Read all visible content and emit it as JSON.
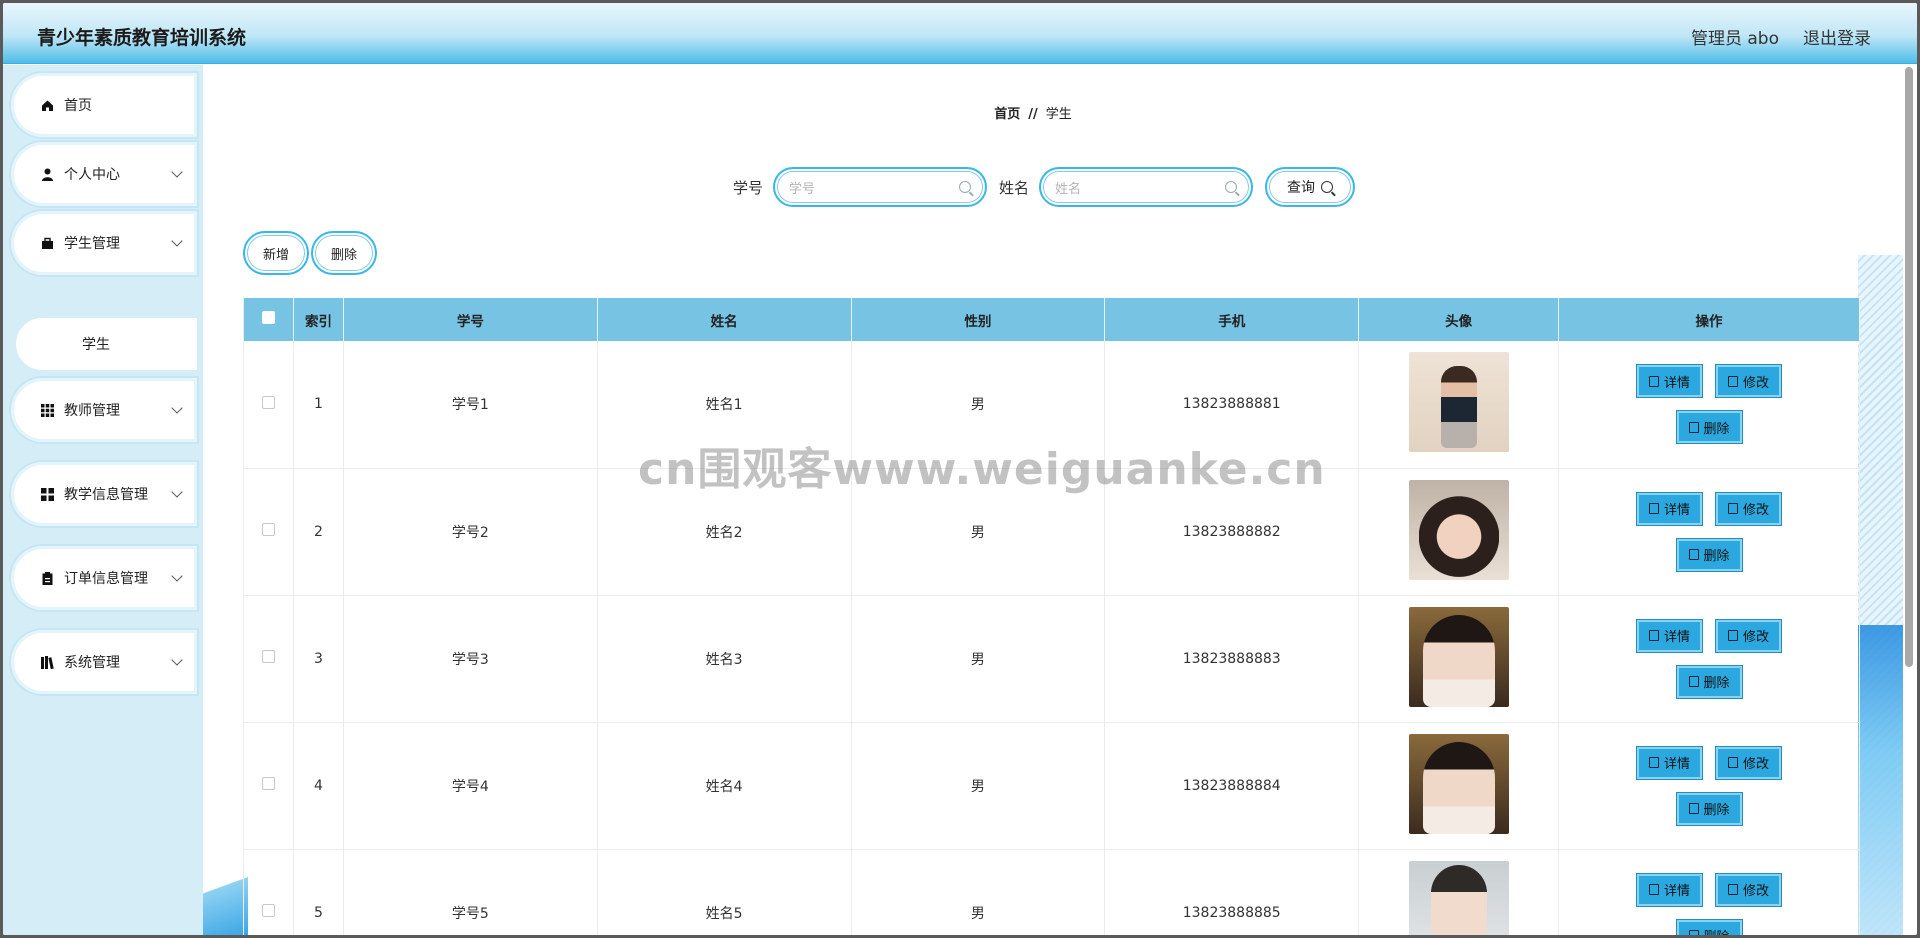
{
  "app": {
    "title": "青少年素质教育培训系统"
  },
  "header": {
    "user": "管理员 abo",
    "logout": "退出登录"
  },
  "sidebar": {
    "items": [
      {
        "label": "首页",
        "icon": "home-icon",
        "expandable": false
      },
      {
        "label": "个人中心",
        "icon": "user-icon",
        "expandable": true
      },
      {
        "label": "学生管理",
        "icon": "briefcase-icon",
        "expandable": true
      },
      {
        "label": "教师管理",
        "icon": "grid-icon",
        "expandable": true
      },
      {
        "label": "教学信息管理",
        "icon": "apps-icon",
        "expandable": true
      },
      {
        "label": "订单信息管理",
        "icon": "clipboard-icon",
        "expandable": true
      },
      {
        "label": "系统管理",
        "icon": "books-icon",
        "expandable": true
      }
    ],
    "sub_item": "学生"
  },
  "breadcrumb": {
    "home": "首页",
    "sep": "//",
    "current": "学生"
  },
  "search": {
    "label_id": "学号",
    "placeholder_id": "学号",
    "label_name": "姓名",
    "placeholder_name": "姓名",
    "query": "查询"
  },
  "actions": {
    "add": "新增",
    "delete": "删除"
  },
  "table": {
    "headers": [
      "索引",
      "学号",
      "姓名",
      "性别",
      "手机",
      "头像",
      "操作"
    ],
    "rows": [
      {
        "index": "1",
        "sid": "学号1",
        "name": "姓名1",
        "gender": "男",
        "phone": "13823888881"
      },
      {
        "index": "2",
        "sid": "学号2",
        "name": "姓名2",
        "gender": "男",
        "phone": "13823888882"
      },
      {
        "index": "3",
        "sid": "学号3",
        "name": "姓名3",
        "gender": "男",
        "phone": "13823888883"
      },
      {
        "index": "4",
        "sid": "学号4",
        "name": "姓名4",
        "gender": "男",
        "phone": "13823888884"
      },
      {
        "index": "5",
        "sid": "学号5",
        "name": "姓名5",
        "gender": "男",
        "phone": "13823888885"
      }
    ],
    "ops": {
      "detail": "详情",
      "edit": "修改",
      "delete": "删除"
    }
  },
  "watermark": "cn围观客www.weiguanke.cn",
  "colors": {
    "accent": "#2aa8df",
    "header_bg": "#4fbde8",
    "table_header": "#77c3e3",
    "sidebar_bg": "#d4edf7"
  }
}
